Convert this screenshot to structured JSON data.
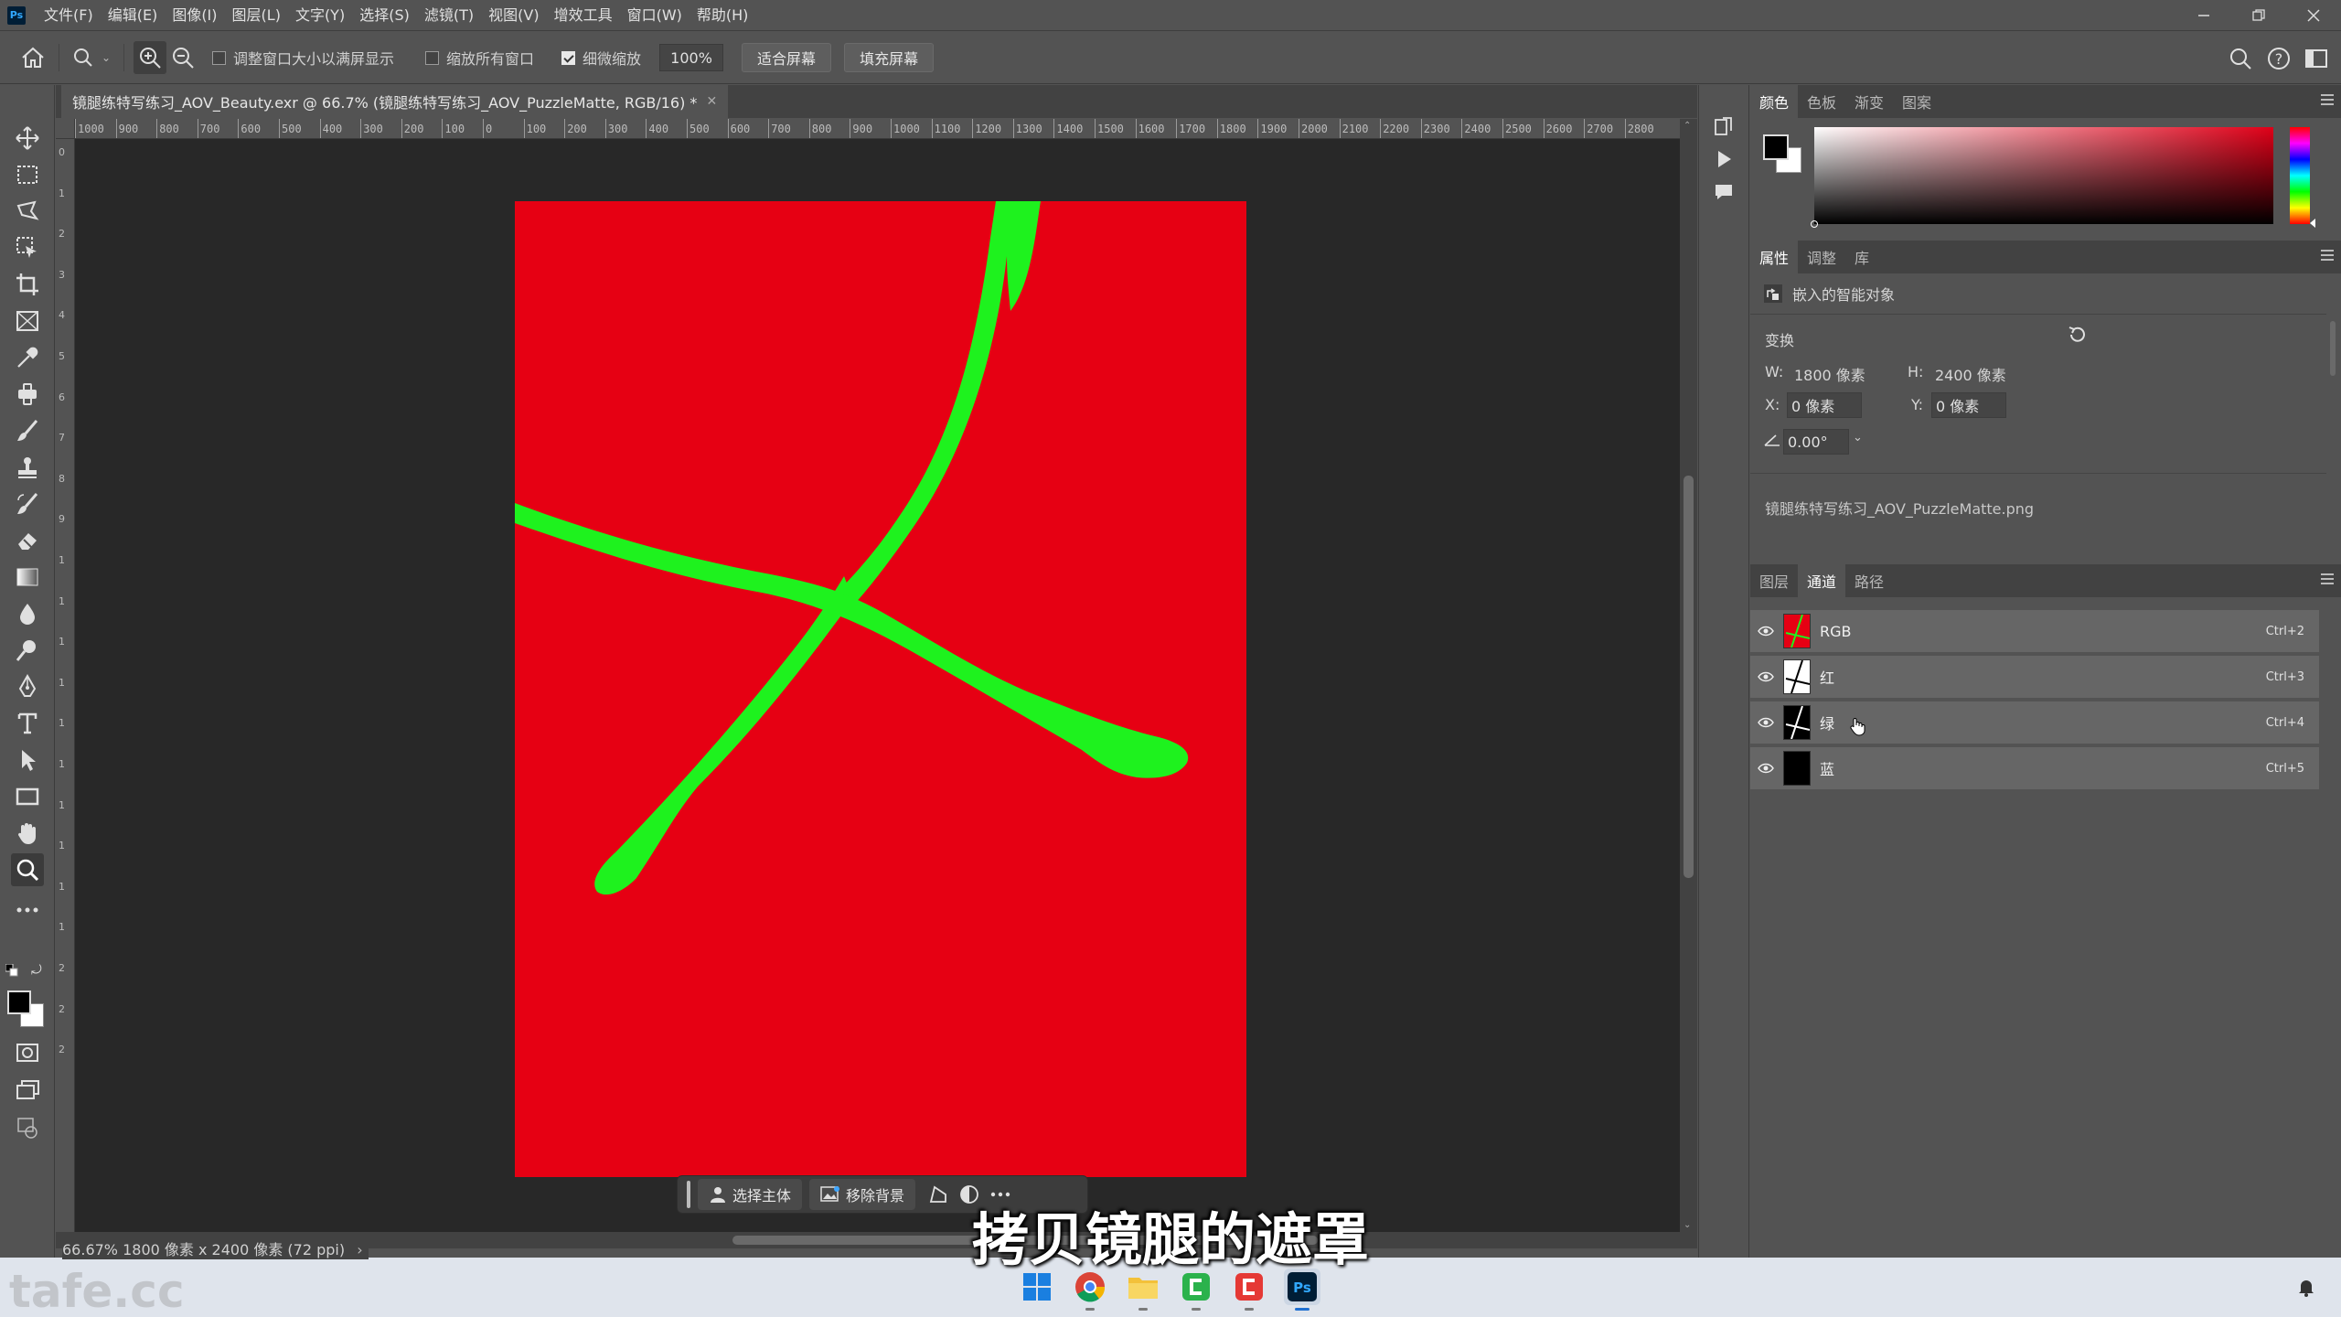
{
  "app": {
    "name": "Photoshop",
    "logo_text": "Ps"
  },
  "menu": [
    "文件(F)",
    "编辑(E)",
    "图像(I)",
    "图层(L)",
    "文字(Y)",
    "选择(S)",
    "滤镜(T)",
    "视图(V)",
    "增效工具",
    "窗口(W)",
    "帮助(H)"
  ],
  "options": {
    "resize_windows_label": "调整窗口大小以满屏显示",
    "resize_windows_checked": false,
    "zoom_all_label": "缩放所有窗口",
    "zoom_all_checked": false,
    "scrubby_zoom_label": "细微缩放",
    "scrubby_zoom_checked": true,
    "zoom_value": "100%",
    "fit_screen_label": "适合屏幕",
    "fill_screen_label": "填充屏幕"
  },
  "document": {
    "tab_title": "镜腿练特写练习_AOV_Beauty.exr @ 66.7% (镜腿练特写练习_AOV_PuzzleMatte, RGB/16) *",
    "canvas_bg_color": "#e60013",
    "shape_color": "#1ef21e"
  },
  "rulers": {
    "horizontal": [
      "1000",
      "900",
      "800",
      "700",
      "600",
      "500",
      "400",
      "300",
      "200",
      "100",
      "0",
      "100",
      "200",
      "300",
      "400",
      "500",
      "600",
      "700",
      "800",
      "900",
      "1000",
      "1100",
      "1200",
      "1300",
      "1400",
      "1500",
      "1600",
      "1700",
      "1800",
      "1900",
      "2000",
      "2100",
      "2200",
      "2300",
      "2400",
      "2500",
      "2600",
      "2700",
      "2800"
    ],
    "vertical": [
      "0",
      "1",
      "2",
      "3",
      "4",
      "5",
      "6",
      "7",
      "8",
      "9",
      "1",
      "1",
      "1",
      "1",
      "1",
      "1",
      "1",
      "1",
      "1",
      "1",
      "2",
      "2",
      "2"
    ]
  },
  "status": {
    "text": "66.67%   1800 像素 x 2400 像素 (72 ppi)"
  },
  "context_bar": {
    "select_subject": "选择主体",
    "remove_background": "移除背景"
  },
  "subtitle": "拷贝镜腿的遮罩",
  "panels": {
    "color_tabs": [
      "颜色",
      "色板",
      "渐变",
      "图案"
    ],
    "props_tabs": [
      "属性",
      "调整",
      "库"
    ],
    "props": {
      "object_type": "嵌入的智能对象",
      "transform_label": "变换",
      "w_label": "W:",
      "w_value": "1800 像素",
      "h_label": "H:",
      "h_value": "2400 像素",
      "x_label": "X:",
      "x_value": "0 像素",
      "y_label": "Y:",
      "y_value": "0 像素",
      "angle_value": "0.00°",
      "linked_file": "镜腿练特写练习_AOV_PuzzleMatte.png"
    },
    "layer_tabs": [
      "图层",
      "通道",
      "路径"
    ],
    "channels": [
      {
        "name": "RGB",
        "shortcut": "Ctrl+2"
      },
      {
        "name": "红",
        "shortcut": "Ctrl+3"
      },
      {
        "name": "绿",
        "shortcut": "Ctrl+4"
      },
      {
        "name": "蓝",
        "shortcut": "Ctrl+5"
      }
    ]
  },
  "taskbar": {
    "watermark": "tafe.cc"
  }
}
